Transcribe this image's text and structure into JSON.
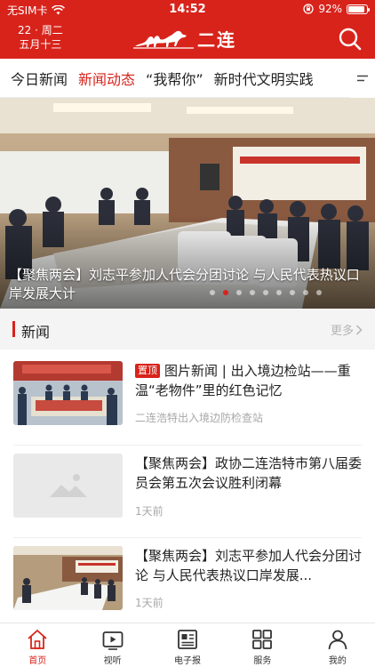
{
  "status_bar": {
    "carrier": "无SIM卡",
    "time": "14:52",
    "battery": "92%",
    "battery_level": 0.92
  },
  "header": {
    "date_line1": "22 · 周二",
    "date_line2": "五月十三",
    "logo_text": "二连",
    "icons": [
      "wifi-icon",
      "orientation-lock-icon",
      "battery-icon",
      "search-icon"
    ]
  },
  "tabs": [
    {
      "label": "今日新闻",
      "active": false
    },
    {
      "label": "新闻动态",
      "active": true
    },
    {
      "label": "“我帮你”",
      "active": false
    },
    {
      "label": "新时代文明实践",
      "active": false
    }
  ],
  "banner": {
    "caption": "【聚焦两会】刘志平参加人代会分团讨论 与人民代表热议口岸发展大计",
    "slide_count": 9,
    "active_slide": 1
  },
  "section": {
    "title": "新闻",
    "more": "更多"
  },
  "news": [
    {
      "tag": "置顶",
      "title": "图片新闻 | 出入境边检站——重温“老物件”里的红色记忆",
      "meta": "二连浩特出入境边防检查站",
      "thumb": "exhibition-photo"
    },
    {
      "tag": "",
      "title": "【聚焦两会】政协二连浩特市第八届委员会第五次会议胜利闭幕",
      "meta": "1天前",
      "thumb": "image-placeholder-icon"
    },
    {
      "tag": "",
      "title": "【聚焦两会】刘志平参加人代会分团讨论 与人民代表热议口岸发展...",
      "meta": "1天前",
      "thumb": "meeting-photo"
    }
  ],
  "bottom_nav": [
    {
      "label": "首页",
      "icon": "home-icon",
      "active": true
    },
    {
      "label": "视听",
      "icon": "video-icon",
      "active": false
    },
    {
      "label": "电子报",
      "icon": "newspaper-icon",
      "active": false
    },
    {
      "label": "服务",
      "icon": "grid-icon",
      "active": false
    },
    {
      "label": "我的",
      "icon": "user-icon",
      "active": false
    }
  ],
  "colors": {
    "brand_red": "#d8231b",
    "muted_text": "#a8a8a8"
  }
}
